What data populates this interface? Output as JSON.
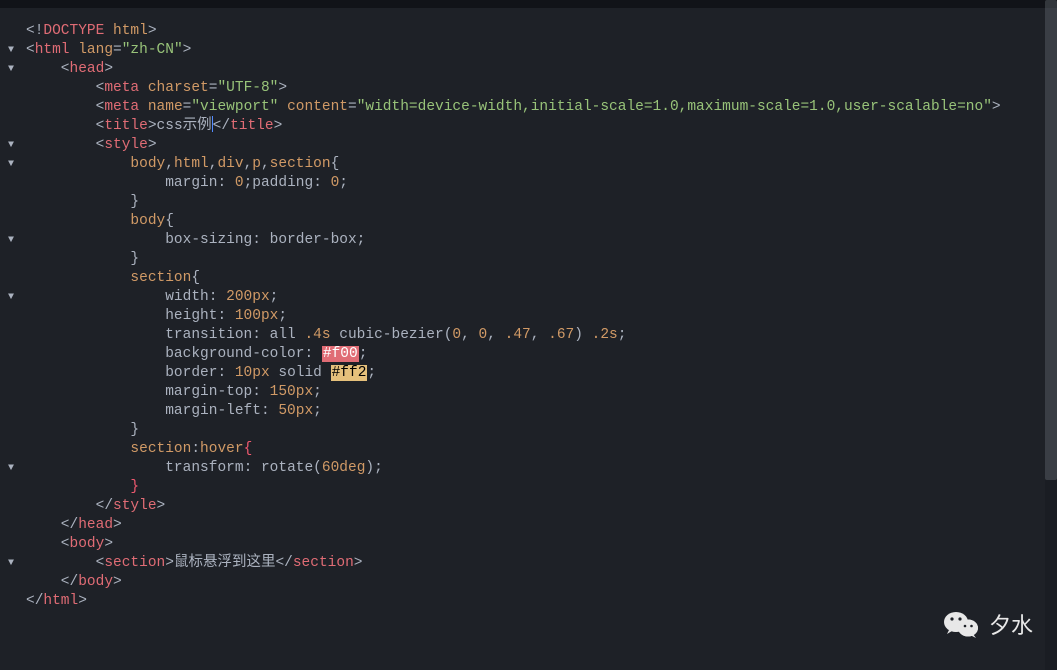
{
  "watermark": "夕水",
  "folds": [
    "",
    "▼",
    "▼",
    "",
    "",
    "",
    "▼",
    "▼",
    "",
    "",
    "",
    "▼",
    "",
    "",
    "▼",
    "",
    "",
    "",
    "",
    "",
    "",
    "",
    "",
    "▼",
    "",
    "",
    "",
    "",
    "▼",
    "",
    "",
    "",
    ""
  ],
  "lines": [
    [
      [
        "c-punct",
        "<!"
      ],
      [
        "c-tag",
        "DOCTYPE"
      ],
      [
        "c-punct",
        " "
      ],
      [
        "c-attr",
        "html"
      ],
      [
        "c-punct",
        ">"
      ]
    ],
    [
      [
        "c-punct",
        "<"
      ],
      [
        "c-tag",
        "html"
      ],
      [
        "c-punct",
        " "
      ],
      [
        "c-attr",
        "lang"
      ],
      [
        "c-punct",
        "="
      ],
      [
        "c-str",
        "\"zh-CN\""
      ],
      [
        "c-punct",
        ">"
      ]
    ],
    [
      [
        "c-punct",
        "    <"
      ],
      [
        "c-tag",
        "head"
      ],
      [
        "c-punct",
        ">"
      ]
    ],
    [
      [
        "c-punct",
        "        <"
      ],
      [
        "c-tag",
        "meta"
      ],
      [
        "c-punct",
        " "
      ],
      [
        "c-attr",
        "charset"
      ],
      [
        "c-punct",
        "="
      ],
      [
        "c-str",
        "\"UTF-8\""
      ],
      [
        "c-punct",
        ">"
      ]
    ],
    [
      [
        "c-punct",
        "        <"
      ],
      [
        "c-tag",
        "meta"
      ],
      [
        "c-punct",
        " "
      ],
      [
        "c-attr",
        "name"
      ],
      [
        "c-punct",
        "="
      ],
      [
        "c-str",
        "\"viewport\""
      ],
      [
        "c-punct",
        " "
      ],
      [
        "c-attr",
        "content"
      ],
      [
        "c-punct",
        "="
      ],
      [
        "c-str",
        "\"width=device-width,initial-scale=1.0,maximum-scale=1.0,user-scalable=no\""
      ],
      [
        "c-punct",
        ">"
      ]
    ],
    [
      [
        "c-punct",
        "        <"
      ],
      [
        "c-tag",
        "title"
      ],
      [
        "c-punct",
        ">"
      ],
      [
        "c-text",
        "css示例"
      ],
      [
        "c-punct",
        "</"
      ],
      [
        "c-tag",
        "title"
      ],
      [
        "c-punct",
        ">"
      ]
    ],
    [
      [
        "c-punct",
        "        <"
      ],
      [
        "c-tag",
        "style"
      ],
      [
        "c-punct",
        ">"
      ]
    ],
    [
      [
        "c-text",
        "            "
      ],
      [
        "c-sel",
        "body"
      ],
      [
        "c-punct",
        ","
      ],
      [
        "c-sel",
        "html"
      ],
      [
        "c-punct",
        ","
      ],
      [
        "c-sel",
        "div"
      ],
      [
        "c-punct",
        ","
      ],
      [
        "c-sel",
        "p"
      ],
      [
        "c-punct",
        ","
      ],
      [
        "c-sel",
        "section"
      ],
      [
        "c-brace",
        "{"
      ]
    ],
    [
      [
        "c-text",
        "                "
      ],
      [
        "c-prop",
        "margin"
      ],
      [
        "c-punct",
        ": "
      ],
      [
        "c-num",
        "0"
      ],
      [
        "c-punct",
        ";"
      ],
      [
        "c-prop",
        "padding"
      ],
      [
        "c-punct",
        ": "
      ],
      [
        "c-num",
        "0"
      ],
      [
        "c-punct",
        ";"
      ]
    ],
    [
      [
        "c-text",
        "            "
      ],
      [
        "c-brace",
        "}"
      ]
    ],
    [
      [
        "c-text",
        "            "
      ],
      [
        "c-sel",
        "body"
      ],
      [
        "c-brace",
        "{"
      ]
    ],
    [
      [
        "c-text",
        "                "
      ],
      [
        "c-prop",
        "box-sizing"
      ],
      [
        "c-punct",
        ": "
      ],
      [
        "c-text",
        "border-box"
      ],
      [
        "c-punct",
        ";"
      ]
    ],
    [
      [
        "c-text",
        "            "
      ],
      [
        "c-brace",
        "}"
      ]
    ],
    [
      [
        "c-text",
        "            "
      ],
      [
        "c-sel",
        "section"
      ],
      [
        "c-brace",
        "{"
      ]
    ],
    [
      [
        "c-text",
        "                "
      ],
      [
        "c-prop",
        "width"
      ],
      [
        "c-punct",
        ": "
      ],
      [
        "c-num",
        "200px"
      ],
      [
        "c-punct",
        ";"
      ]
    ],
    [
      [
        "c-text",
        "                "
      ],
      [
        "c-prop",
        "height"
      ],
      [
        "c-punct",
        ": "
      ],
      [
        "c-num",
        "100px"
      ],
      [
        "c-punct",
        ";"
      ]
    ],
    [
      [
        "c-text",
        "                "
      ],
      [
        "c-prop",
        "transition"
      ],
      [
        "c-punct",
        ": "
      ],
      [
        "c-text",
        "all "
      ],
      [
        "c-num",
        ".4s"
      ],
      [
        "c-text",
        " cubic-bezier("
      ],
      [
        "c-num",
        "0"
      ],
      [
        "c-punct",
        ", "
      ],
      [
        "c-num",
        "0"
      ],
      [
        "c-punct",
        ", "
      ],
      [
        "c-num",
        ".47"
      ],
      [
        "c-punct",
        ", "
      ],
      [
        "c-num",
        ".67"
      ],
      [
        "c-punct",
        ") "
      ],
      [
        "c-num",
        ".2s"
      ],
      [
        "c-punct",
        ";"
      ]
    ],
    [
      [
        "c-text",
        "                "
      ],
      [
        "c-prop",
        "background-color"
      ],
      [
        "c-punct",
        ": "
      ],
      [
        "hl-red",
        "#f00"
      ],
      [
        "c-punct",
        ";"
      ]
    ],
    [
      [
        "c-text",
        "                "
      ],
      [
        "c-prop",
        "border"
      ],
      [
        "c-punct",
        ": "
      ],
      [
        "c-num",
        "10px"
      ],
      [
        "c-text",
        " solid "
      ],
      [
        "hl-yellow",
        "#ff2"
      ],
      [
        "c-punct",
        ";"
      ]
    ],
    [
      [
        "c-text",
        "                "
      ],
      [
        "c-prop",
        "margin-top"
      ],
      [
        "c-punct",
        ": "
      ],
      [
        "c-num",
        "150px"
      ],
      [
        "c-punct",
        ";"
      ]
    ],
    [
      [
        "c-text",
        "                "
      ],
      [
        "c-prop",
        "margin-left"
      ],
      [
        "c-punct",
        ": "
      ],
      [
        "c-num",
        "50px"
      ],
      [
        "c-punct",
        ";"
      ]
    ],
    [
      [
        "c-text",
        "            "
      ],
      [
        "c-brace",
        "}"
      ]
    ],
    [
      [
        "c-text",
        "            "
      ],
      [
        "c-sel",
        "section"
      ],
      [
        "c-punct",
        ":"
      ],
      [
        "c-sel",
        "hover"
      ],
      [
        "c-pinkb",
        "{"
      ]
    ],
    [
      [
        "c-text",
        "                "
      ],
      [
        "c-prop",
        "transform"
      ],
      [
        "c-punct",
        ": "
      ],
      [
        "c-text",
        "rotate("
      ],
      [
        "c-num",
        "60deg"
      ],
      [
        "c-punct",
        ");"
      ]
    ],
    [
      [
        "c-text",
        "            "
      ],
      [
        "c-pinkb",
        "}"
      ]
    ],
    [
      [
        "c-punct",
        "        </"
      ],
      [
        "c-tag",
        "style"
      ],
      [
        "c-punct",
        ">"
      ]
    ],
    [
      [
        "c-punct",
        "    </"
      ],
      [
        "c-tag",
        "head"
      ],
      [
        "c-punct",
        ">"
      ]
    ],
    [
      [
        "c-punct",
        "    <"
      ],
      [
        "c-tag",
        "body"
      ],
      [
        "c-punct",
        ">"
      ]
    ],
    [
      [
        "c-punct",
        "        <"
      ],
      [
        "c-tag",
        "section"
      ],
      [
        "c-punct",
        ">"
      ],
      [
        "c-text",
        "鼠标悬浮到这里"
      ],
      [
        "c-punct",
        "</"
      ],
      [
        "c-tag",
        "section"
      ],
      [
        "c-punct",
        ">"
      ]
    ],
    [
      [
        "c-punct",
        "    </"
      ],
      [
        "c-tag",
        "body"
      ],
      [
        "c-punct",
        ">"
      ]
    ],
    [
      [
        "c-punct",
        "</"
      ],
      [
        "c-tag",
        "html"
      ],
      [
        "c-punct",
        ">"
      ]
    ]
  ]
}
